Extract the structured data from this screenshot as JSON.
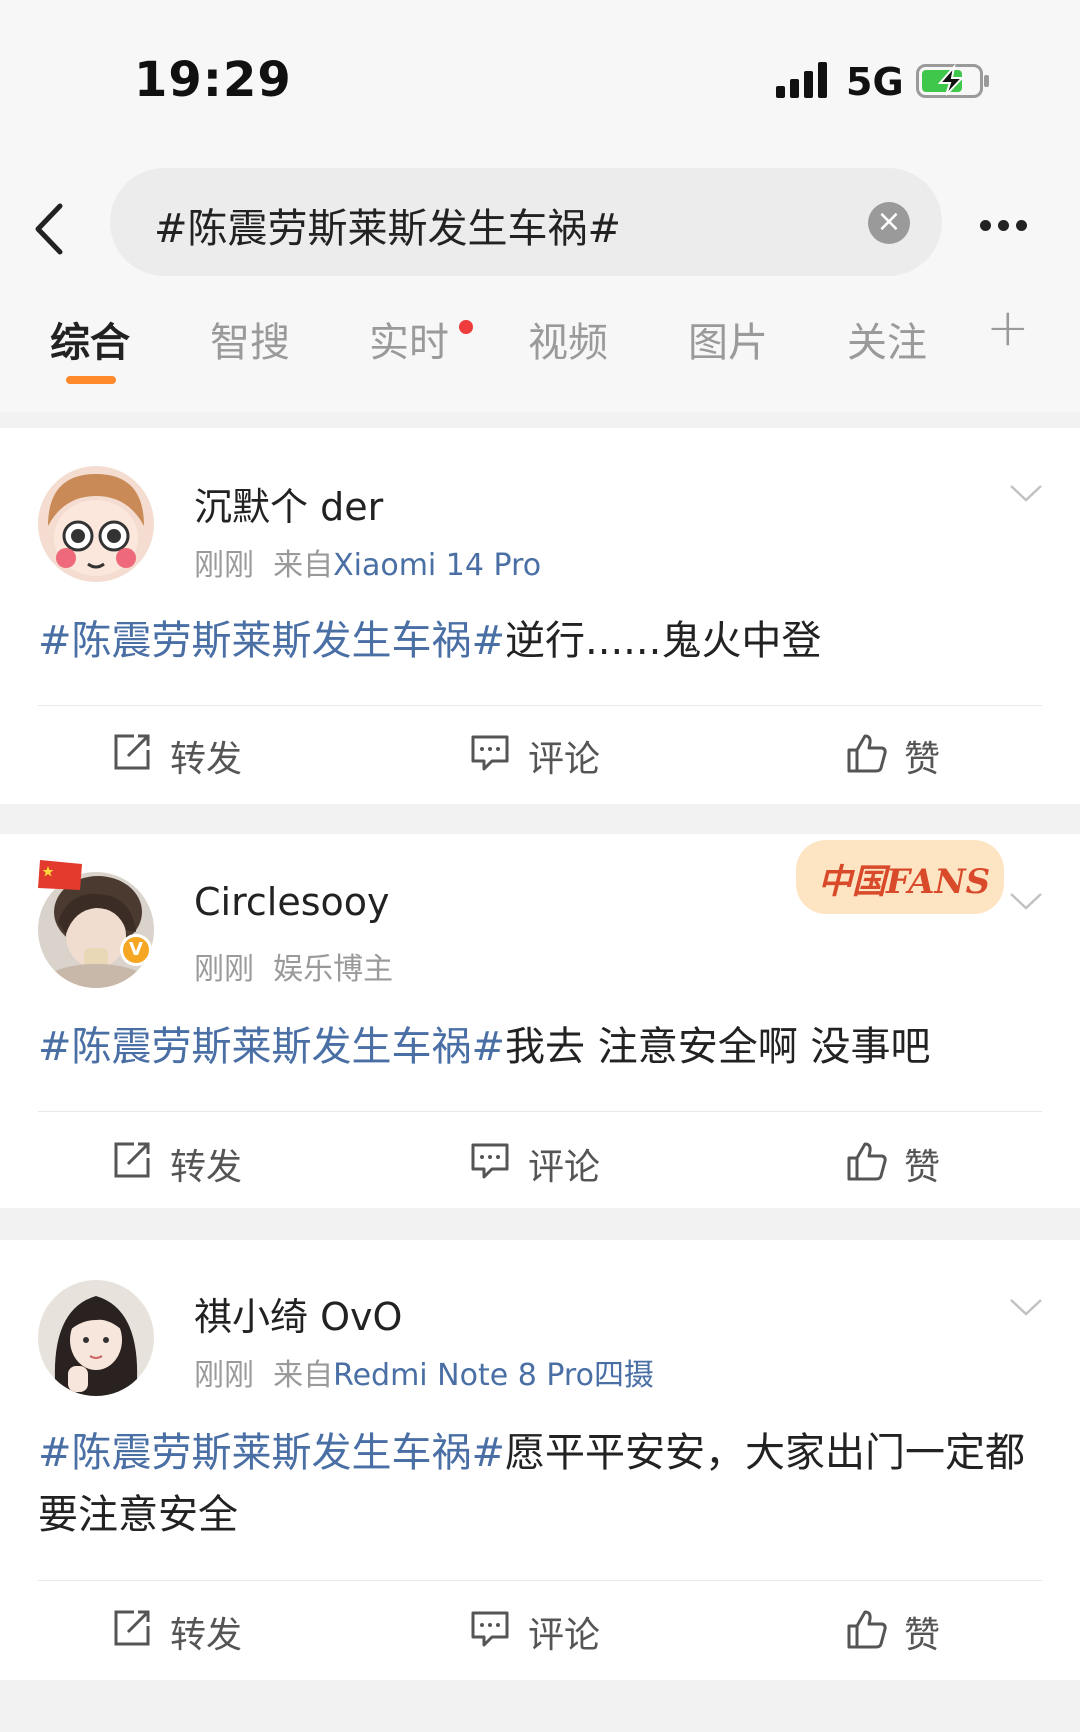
{
  "status_bar": {
    "time": "19:29",
    "network": "5G"
  },
  "search": {
    "query": "#陈震劳斯莱斯发生车祸#"
  },
  "tabs": [
    {
      "label": "综合"
    },
    {
      "label": "智搜"
    },
    {
      "label": "实时"
    },
    {
      "label": "视频"
    },
    {
      "label": "图片"
    },
    {
      "label": "关注"
    }
  ],
  "posts": [
    {
      "username": "沉默个 der",
      "time": "刚刚",
      "from_prefix": "来自",
      "source": "Xiaomi 14 Pro",
      "hashtag": "#陈震劳斯莱斯发生车祸#",
      "text": "逆行......鬼火中登"
    },
    {
      "username": "Circlesooy",
      "time": "刚刚",
      "role": "娱乐博主",
      "badge_text": "中国FANS",
      "hashtag": "#陈震劳斯莱斯发生车祸#",
      "text": "我去 注意安全啊 没事吧"
    },
    {
      "username": "祺小绮 OvO",
      "time": "刚刚",
      "from_prefix": "来自",
      "source": "Redmi Note 8 Pro四摄",
      "hashtag": "#陈震劳斯莱斯发生车祸#",
      "text": "愿平平安安，大家出门一定都要注意安全"
    }
  ],
  "actions": {
    "repost": "转发",
    "comment": "评论",
    "like": "赞"
  }
}
